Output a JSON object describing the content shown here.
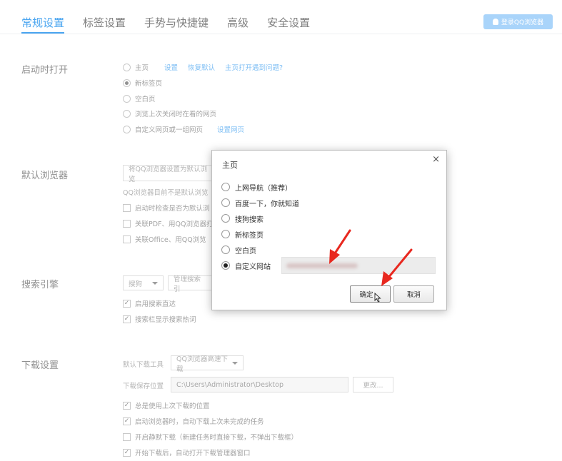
{
  "tabs": [
    {
      "label": "常规设置",
      "active": true
    },
    {
      "label": "标签设置"
    },
    {
      "label": "手势与快捷键"
    },
    {
      "label": "高级"
    },
    {
      "label": "安全设置"
    }
  ],
  "login_button": "登录QQ浏览器",
  "startup": {
    "title": "启动时打开",
    "options": [
      "主页",
      "新标签页",
      "空白页",
      "浏览上次关闭时在看的网页",
      "自定义网页或一组网页"
    ],
    "homepage_links": [
      "设置",
      "恢复默认",
      "主页打开遇到问题?"
    ],
    "custom_link": "设置网页"
  },
  "default_browser": {
    "title": "默认浏览器",
    "set_default": "将QQ浏览器设置为默认浏览",
    "status": "QQ浏览器目前不是默认浏览",
    "options": [
      "启动时检查是否为默认浏",
      "关联PDF、用QQ浏览器打",
      "关联Office、用QQ浏览"
    ]
  },
  "search": {
    "title": "搜索引擎",
    "engine": "搜狗",
    "manage": "管理搜索引",
    "options": [
      "启用搜索直达",
      "搜索栏显示搜索热词"
    ]
  },
  "download": {
    "title": "下载设置",
    "tool_label": "默认下载工具",
    "tool_value": "QQ浏览器高速下载",
    "path_label": "下载保存位置",
    "path_value": "C:\\Users\\Administrator\\Desktop",
    "change": "更改...",
    "options": [
      "总是使用上次下载的位置",
      "启动浏览器时，自动下载上次未完成的任务",
      "开启静默下载（新建任务时直接下载，不弹出下载框）",
      "开始下载后，自动打开下载管理器窗口"
    ]
  },
  "modal": {
    "title": "主页",
    "close": "×",
    "options": [
      "上网导航（推荐）",
      "百度一下，你就知道",
      "搜狗搜索",
      "新标签页",
      "空白页",
      "自定义网站"
    ],
    "selected": 5,
    "ok": "确定",
    "cancel": "取消"
  },
  "colors": {
    "accent": "#4aa5f0",
    "arrow": "#e8281f"
  }
}
